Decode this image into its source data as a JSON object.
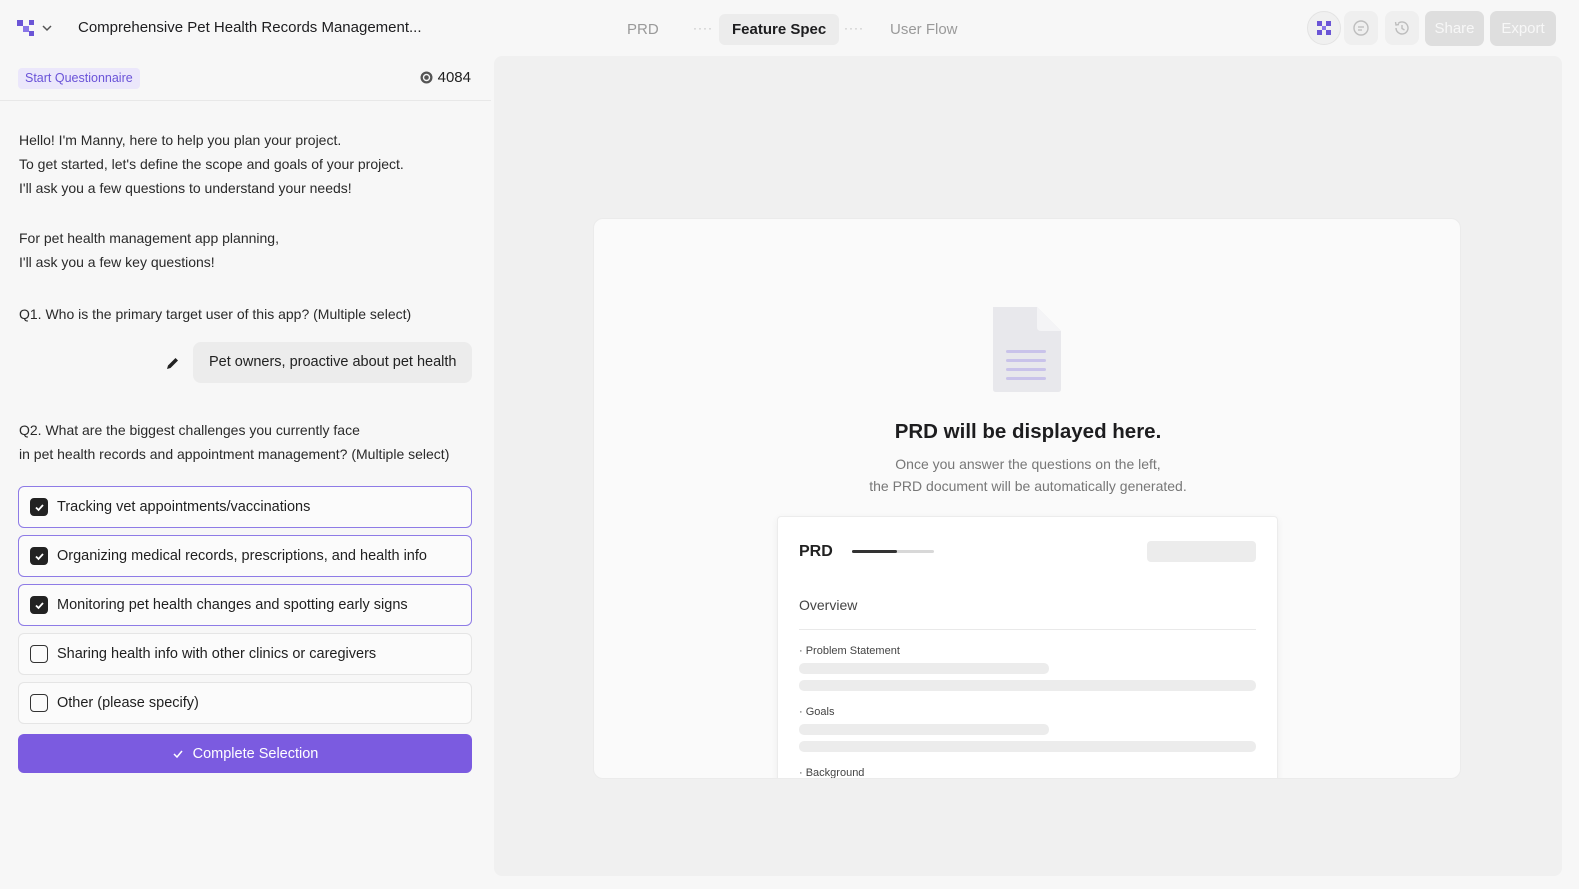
{
  "header": {
    "doc_title": "Comprehensive Pet Health Records Management...",
    "tabs": [
      {
        "label": "PRD",
        "active": false
      },
      {
        "label": "Feature Spec",
        "active": true
      },
      {
        "label": "User Flow",
        "active": false
      }
    ],
    "tab_separator": "····",
    "share_label": "Share",
    "export_label": "Export"
  },
  "left": {
    "badge": "Start Questionnaire",
    "credits": "4084",
    "intro": [
      "Hello! I'm Manny, here to help you plan your project.",
      "To get started, let's define the scope and goals of your project.",
      "I'll ask you a few questions to understand your needs!"
    ],
    "intro2": [
      "For pet health management app planning,",
      "I'll ask you a few key questions!"
    ],
    "q1": "Q1. Who is the primary target user of this app? (Multiple select)",
    "q1_answer": "Pet owners, proactive about pet health",
    "q2": [
      "Q2. What are the biggest challenges you currently face",
      "in pet health records and appointment management? (Multiple select)"
    ],
    "options": [
      {
        "label": "Tracking vet appointments/vaccinations",
        "checked": true
      },
      {
        "label": "Organizing medical records, prescriptions, and health info",
        "checked": true
      },
      {
        "label": "Monitoring pet health changes and spotting early signs",
        "checked": true
      },
      {
        "label": "Sharing health info with other clinics or caregivers",
        "checked": false
      },
      {
        "label": "Other (please specify)",
        "checked": false
      }
    ],
    "complete_label": "Complete Selection"
  },
  "right": {
    "empty_title": "PRD will be displayed here.",
    "empty_sub": [
      "Once you answer the questions on the left,",
      "the PRD document will be automatically generated."
    ],
    "preview": {
      "title": "PRD",
      "progress": 0.55,
      "section": "Overview",
      "items": [
        "· Problem Statement",
        "· Goals",
        "· Background"
      ]
    }
  },
  "colors": {
    "accent": "#7b5be0",
    "badge_bg": "#ebe7fb",
    "badge_text": "#6a53d8",
    "checked_border": "#8e7be6"
  }
}
